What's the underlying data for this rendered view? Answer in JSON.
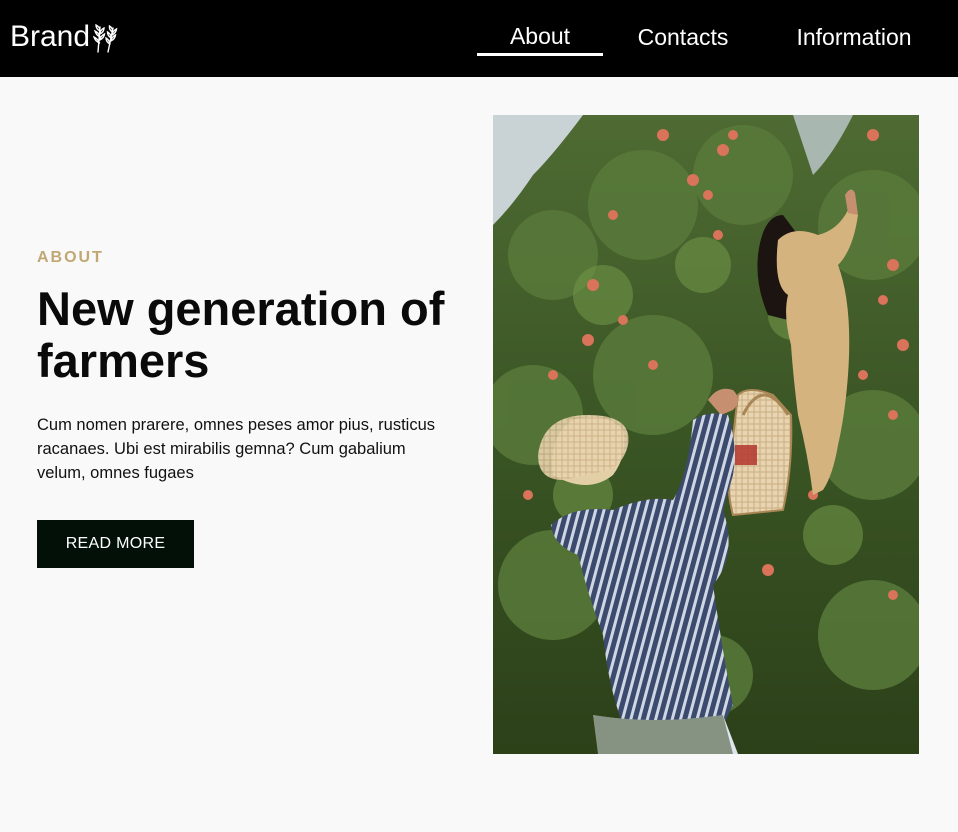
{
  "nav": {
    "brand_label": "Brand",
    "brand_icon": "wheat-icon",
    "items": [
      {
        "label": "About",
        "active": true
      },
      {
        "label": "Contacts",
        "active": false
      },
      {
        "label": "Information",
        "active": false
      }
    ]
  },
  "hero": {
    "eyebrow": "ABOUT",
    "title": "New generation of farmers",
    "body": "Cum nomen prarere, omnes peses amor pius, rusticus racanaes. Ubi est mirabilis gemna? Cum gabalium velum, omnes fugaes",
    "cta_label": "READ MORE",
    "image_alt": "Two people picking apples in an orchard"
  },
  "colors": {
    "navbar_bg": "#000000",
    "page_bg": "#f9f9f9",
    "accent": "#c0a774",
    "button_bg": "#021007"
  }
}
